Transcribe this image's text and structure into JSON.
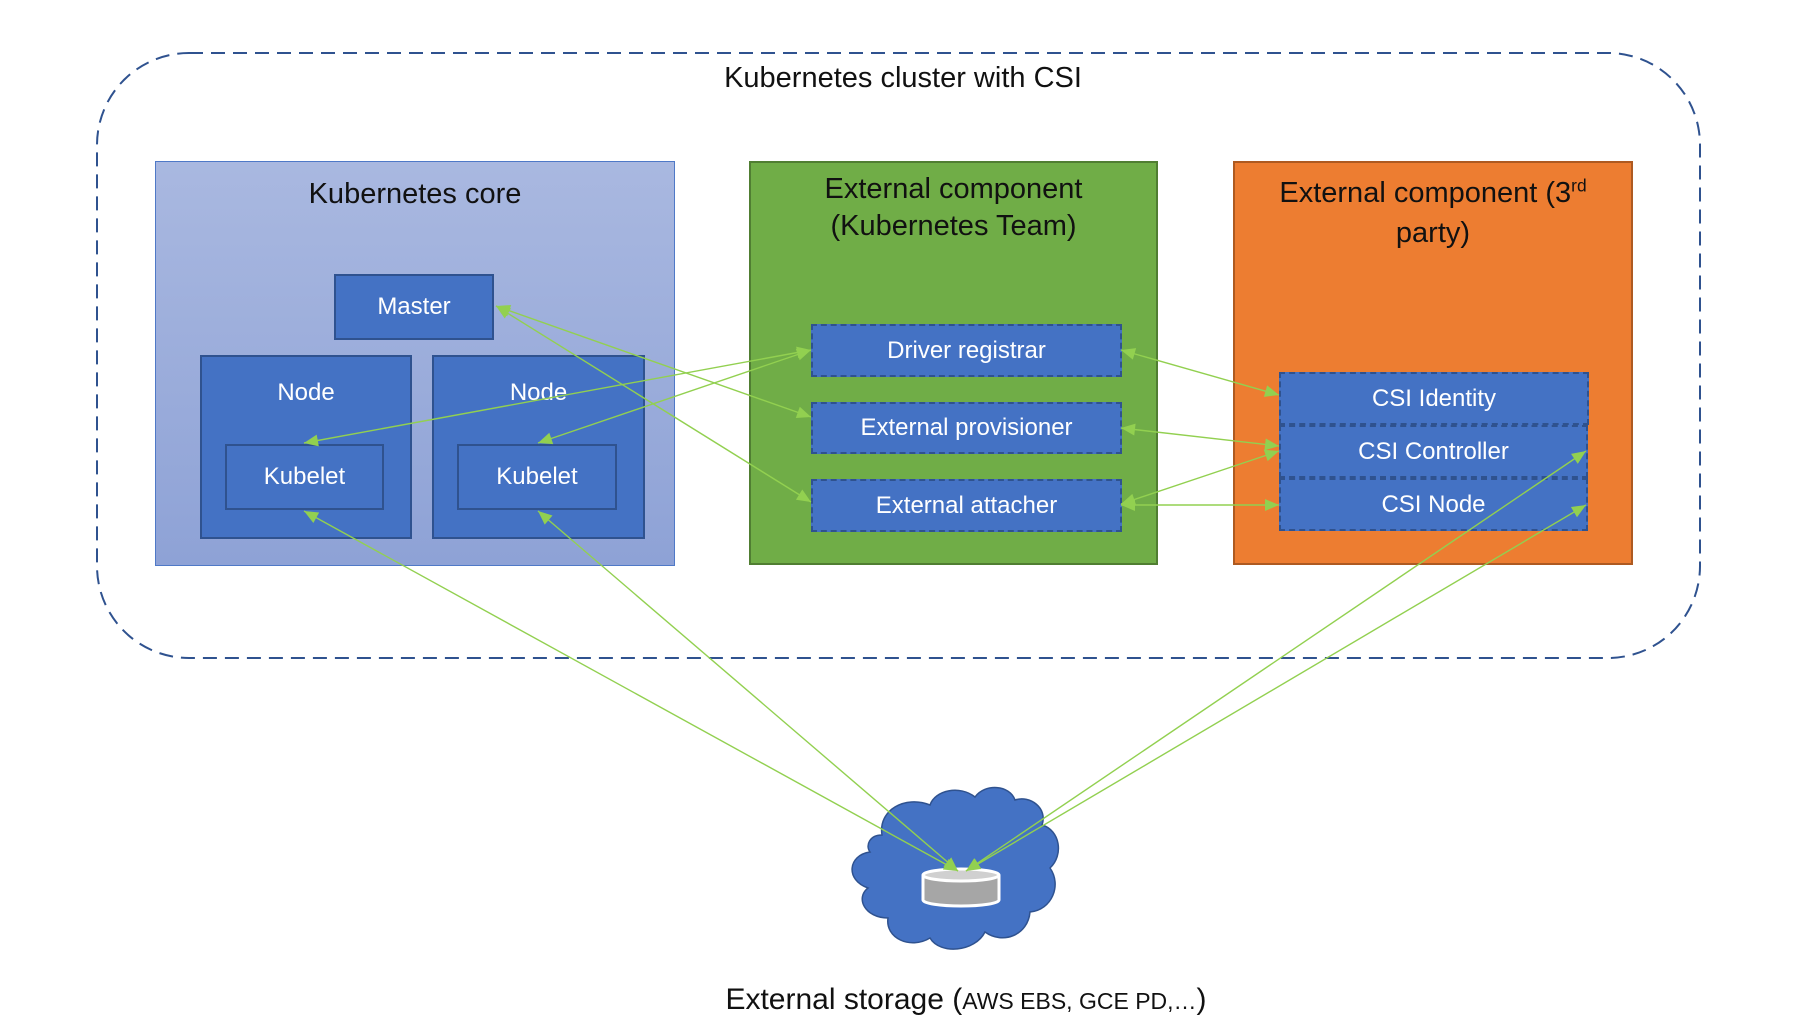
{
  "cluster": {
    "title": "Kubernetes cluster with CSI",
    "border_color": "#2f528f"
  },
  "groups": {
    "core": {
      "title": "Kubernetes core",
      "color": "#a4b3dc",
      "master": "Master",
      "nodes": [
        {
          "label": "Node",
          "kubelet": "Kubelet"
        },
        {
          "label": "Node",
          "kubelet": "Kubelet"
        }
      ]
    },
    "k8s_team": {
      "title_line1": "External component",
      "title_line2": "(Kubernetes Team)",
      "color": "#70ad47",
      "components": [
        "Driver registrar",
        "External provisioner",
        "External attacher"
      ]
    },
    "third_party": {
      "title_prefix": "External component (3",
      "title_sup": "rd",
      "title_line2": "party)",
      "color": "#ed7d31",
      "components": [
        "CSI Identity",
        "CSI Controller",
        "CSI Node"
      ]
    }
  },
  "storage": {
    "label_main": "External storage (",
    "label_detail": "AWS EBS, GCE PD,…",
    "label_close": ")",
    "icon": "database-cylinder-icon",
    "cloud_color": "#4472c4"
  },
  "connections": [
    {
      "from": "Master",
      "to": "External provisioner",
      "bidirectional": true
    },
    {
      "from": "Master",
      "to": "External attacher",
      "bidirectional": true
    },
    {
      "from": "Driver registrar",
      "to": "Kubelet (Node 1)",
      "bidirectional": true
    },
    {
      "from": "Driver registrar",
      "to": "Kubelet (Node 2)",
      "bidirectional": true
    },
    {
      "from": "Driver registrar",
      "to": "CSI Identity",
      "bidirectional": true
    },
    {
      "from": "External provisioner",
      "to": "CSI Controller",
      "bidirectional": true
    },
    {
      "from": "External attacher",
      "to": "CSI Controller",
      "bidirectional": true
    },
    {
      "from": "External attacher",
      "to": "CSI Node",
      "bidirectional": true
    },
    {
      "from": "Kubelet (Node 1)",
      "to": "External storage",
      "bidirectional": true
    },
    {
      "from": "Kubelet (Node 2)",
      "to": "External storage",
      "bidirectional": true
    },
    {
      "from": "CSI Controller",
      "to": "External storage",
      "bidirectional": true
    },
    {
      "from": "CSI Node",
      "to": "External storage",
      "bidirectional": true
    }
  ],
  "arrow_color": "#92d050"
}
